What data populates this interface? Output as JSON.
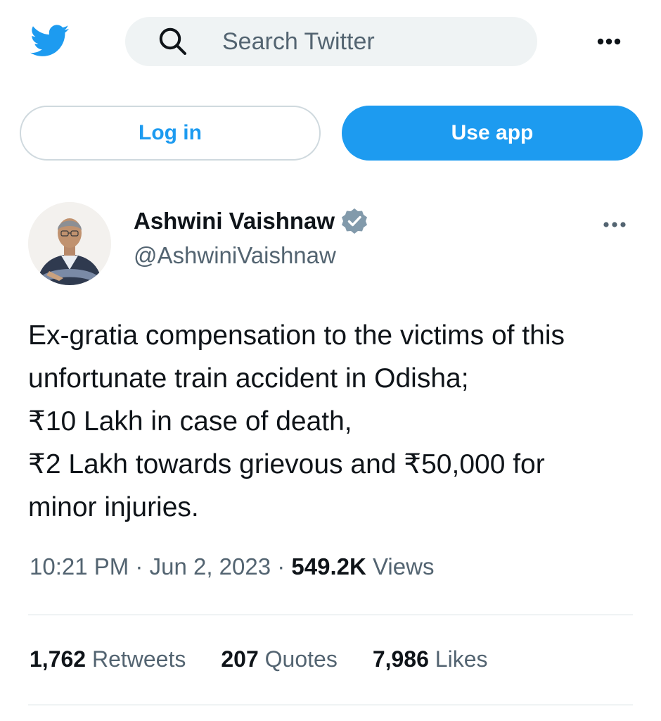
{
  "header": {
    "search_placeholder": "Search Twitter"
  },
  "actions": {
    "login_label": "Log in",
    "use_app_label": "Use app"
  },
  "tweet": {
    "author_name": "Ashwini Vaishnaw",
    "author_handle": "@AshwiniVaishnaw",
    "text_lines": [
      "Ex-gratia compensation to the victims of this",
      "unfortunate train accident in Odisha;",
      "₹10 Lakh in case of death,",
      "₹2 Lakh towards grievous and ₹50,000 for",
      "minor injuries."
    ],
    "time": "10:21 PM",
    "date": "Jun 2, 2023",
    "separator": "·",
    "views_count": "549.2K",
    "views_label": "Views",
    "stats": [
      {
        "count": "1,762",
        "label": "Retweets"
      },
      {
        "count": "207",
        "label": "Quotes"
      },
      {
        "count": "7,986",
        "label": "Likes"
      }
    ]
  },
  "icons": {
    "logo": "twitter-bird-icon",
    "search": "search-icon",
    "more": "more-horizontal-icon",
    "verified": "verified-badge-icon"
  },
  "colors": {
    "brand": "#1d9bf0",
    "text_primary": "#0f1419",
    "text_secondary": "#536471",
    "search_bg": "#eff3f4",
    "verified_badge": "#829aab"
  }
}
